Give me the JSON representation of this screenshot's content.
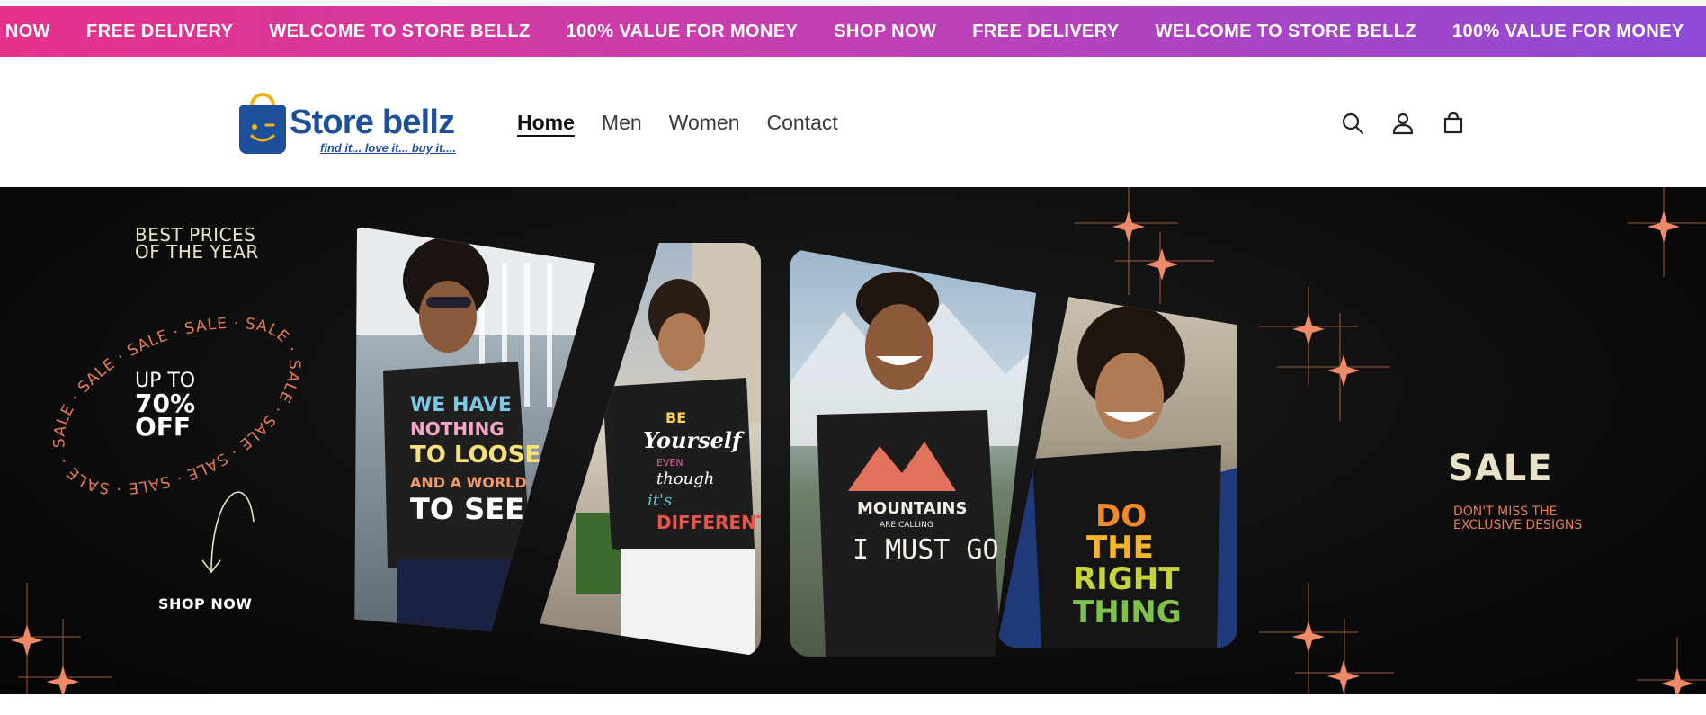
{
  "announcement": {
    "items": [
      "SHOP NOW",
      "FREE DELIVERY",
      "WELCOME TO STORE BELLZ",
      "100% VALUE FOR MONEY",
      "SHOP NOW",
      "FREE DELIVERY",
      "WELCOME TO STORE BELLZ",
      "100% VALUE FOR MONEY"
    ],
    "gradient": [
      "#e6318a",
      "#8e4ad6"
    ]
  },
  "header": {
    "logo": {
      "name": "Store bellz",
      "tagline": "find it... love it... buy it....",
      "brand_color": "#1e4f9a",
      "accent_color": "#f2b316"
    },
    "nav": [
      {
        "label": "Home",
        "active": true
      },
      {
        "label": "Men",
        "active": false
      },
      {
        "label": "Women",
        "active": false
      },
      {
        "label": "Contact",
        "active": false
      }
    ],
    "icons": [
      "search-icon",
      "account-icon",
      "cart-icon"
    ]
  },
  "hero": {
    "best_prices_line1": "BEST PRICES",
    "best_prices_line2": "OF THE YEAR",
    "ring_text": "SALE · SALE · SALE · SALE · SALE · SALE · SALE · SALE · SALE · SALE ·",
    "upto_line1": "UP TO",
    "upto_line2": "70%",
    "upto_line3": "OFF",
    "shop_now": "SHOP NOW",
    "sale_title": "SALE",
    "sale_sub_line1": "DON'T MISS THE",
    "sale_sub_line2": "EXCLUSIVE  DESIGNS",
    "accent_color": "#e57a58",
    "photos": [
      {
        "shirt_text": [
          "WE HAVE",
          "NOTHING",
          "TO LOOSE",
          "AND A WORLD",
          "TO SEE"
        ]
      },
      {
        "shirt_text": [
          "BE",
          "Yourself",
          "EVEN",
          "though",
          "it's",
          "DIFFERENT"
        ]
      },
      {
        "shirt_text": [
          "MOUNTAINS",
          "ARE CALLING",
          "I MUST GO."
        ]
      },
      {
        "shirt_text": [
          "DO",
          "THE",
          "RIGHT",
          "THING"
        ]
      }
    ]
  }
}
